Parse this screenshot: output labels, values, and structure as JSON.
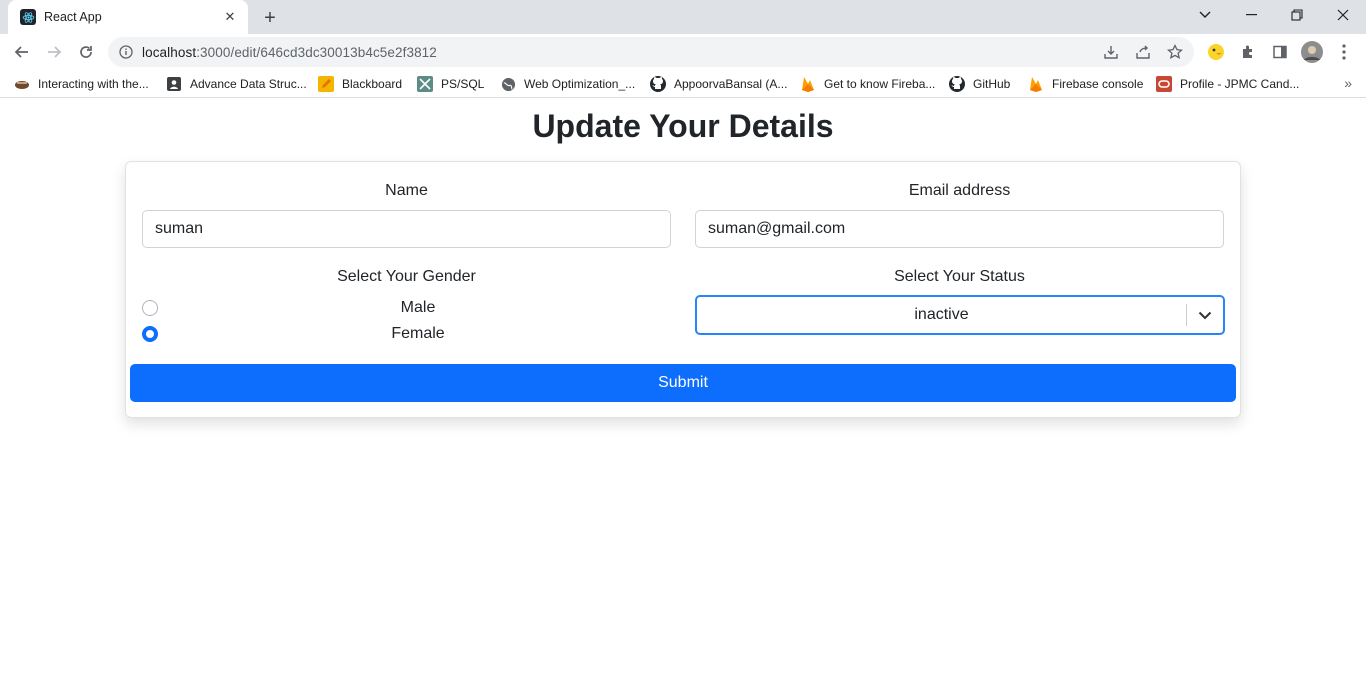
{
  "browser": {
    "tab_title": "React App",
    "url_host": "localhost",
    "url_path": ":3000/edit/646cd3dc30013b4c5e2f3812",
    "bookmarks": [
      {
        "label": "Interacting with the...",
        "icon": "bookmark-reading-icon"
      },
      {
        "label": "Advance Data Struc...",
        "icon": "contact-card-icon"
      },
      {
        "label": "Blackboard",
        "icon": "pencil-icon"
      },
      {
        "label": "PS/SQL",
        "icon": "sql-icon"
      },
      {
        "label": "Web Optimization_...",
        "icon": "globe-icon"
      },
      {
        "label": "AppoorvaBansal (A...",
        "icon": "github-icon"
      },
      {
        "label": "Get to know Fireba...",
        "icon": "firebase-icon"
      },
      {
        "label": "GitHub",
        "icon": "github-icon"
      },
      {
        "label": "Firebase console",
        "icon": "firebase-icon"
      },
      {
        "label": "Profile - JPMC Cand...",
        "icon": "oracle-icon"
      }
    ]
  },
  "page": {
    "title": "Update Your Details"
  },
  "form": {
    "name_label": "Name",
    "name_value": "suman",
    "email_label": "Email address",
    "email_value": "suman@gmail.com",
    "gender_label": "Select Your Gender",
    "gender_options": [
      {
        "label": "Male",
        "checked": false
      },
      {
        "label": "Female",
        "checked": true
      }
    ],
    "status_label": "Select Your Status",
    "status_value": "inactive",
    "submit_label": "Submit"
  },
  "colors": {
    "primary": "#0d6efd",
    "select_focus": "#2684ff"
  }
}
